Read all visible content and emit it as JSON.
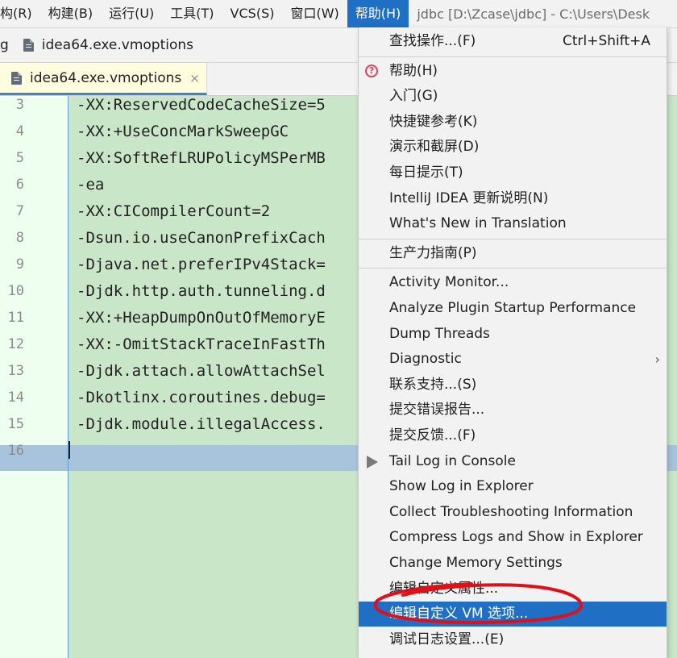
{
  "menubar": {
    "items": [
      "构(R)",
      "构建(B)",
      "运行(U)",
      "工具(T)",
      "VCS(S)",
      "窗口(W)",
      "帮助(H)"
    ],
    "title": "jdbc [D:\\Zcase\\jdbc] - C:\\Users\\Desk"
  },
  "navbar": {
    "prefix": "g",
    "file": "idea64.exe.vmoptions"
  },
  "tab": {
    "label": "idea64.exe.vmoptions",
    "close": "×"
  },
  "editor": {
    "lines": [
      {
        "n": "3",
        "text": "-XX:ReservedCodeCacheSize=5"
      },
      {
        "n": "4",
        "text": "-XX:+UseConcMarkSweepGC"
      },
      {
        "n": "5",
        "text": "-XX:SoftRefLRUPolicyMSPerMB"
      },
      {
        "n": "6",
        "text": "-ea"
      },
      {
        "n": "7",
        "text": "-XX:CICompilerCount=2"
      },
      {
        "n": "8",
        "text": "-Dsun.io.useCanonPrefixCach"
      },
      {
        "n": "9",
        "text": "-Djava.net.preferIPv4Stack="
      },
      {
        "n": "10",
        "text": "-Djdk.http.auth.tunneling.d"
      },
      {
        "n": "11",
        "text": "-XX:+HeapDumpOnOutOfMemoryE"
      },
      {
        "n": "12",
        "text": "-XX:-OmitStackTraceInFastTh"
      },
      {
        "n": "13",
        "text": "-Djdk.attach.allowAttachSel"
      },
      {
        "n": "14",
        "text": "-Dkotlinx.coroutines.debug="
      },
      {
        "n": "15",
        "text": "-Djdk.module.illegalAccess."
      },
      {
        "n": "16",
        "text": ""
      }
    ]
  },
  "help_menu": {
    "groups": [
      [
        {
          "label": "查找操作...(F)",
          "shortcut": "Ctrl+Shift+A"
        }
      ],
      [
        {
          "label": "帮助(H)",
          "icon": "help-icon"
        },
        {
          "label": "入门(G)"
        },
        {
          "label": "快捷键参考(K)"
        },
        {
          "label": "演示和截屏(D)"
        },
        {
          "label": "每日提示(T)"
        },
        {
          "label": "IntelliJ IDEA 更新说明(N)"
        },
        {
          "label": "What's New in Translation"
        }
      ],
      [
        {
          "label": "生产力指南(P)"
        }
      ],
      [
        {
          "label": "Activity Monitor..."
        },
        {
          "label": "Analyze Plugin Startup Performance"
        },
        {
          "label": "Dump Threads"
        },
        {
          "label": "Diagnostic",
          "submenu": true
        },
        {
          "label": "联系支持...(S)"
        },
        {
          "label": "提交错误报告..."
        },
        {
          "label": "提交反馈...(F)"
        },
        {
          "label": "Tail Log in Console",
          "icon": "play-icon"
        },
        {
          "label": "Show Log in Explorer"
        },
        {
          "label": "Collect Troubleshooting Information"
        },
        {
          "label": "Compress Logs and Show in Explorer"
        },
        {
          "label": "Change Memory Settings"
        },
        {
          "label": "编辑自定义属性..."
        },
        {
          "label": "编辑自定义 VM 选项...",
          "selected": true
        },
        {
          "label": "调试日志设置...(E)"
        }
      ]
    ]
  },
  "colors": {
    "accent": "#1f6fc4",
    "editor_bg": "#c9e6c9",
    "gutter_bg": "#efffef",
    "highlight_line": "#a8c3dc",
    "annotation": "#e0101a"
  },
  "icons": [
    "file-icon",
    "help-icon",
    "play-icon",
    "chevron-right-icon",
    "close-icon"
  ]
}
